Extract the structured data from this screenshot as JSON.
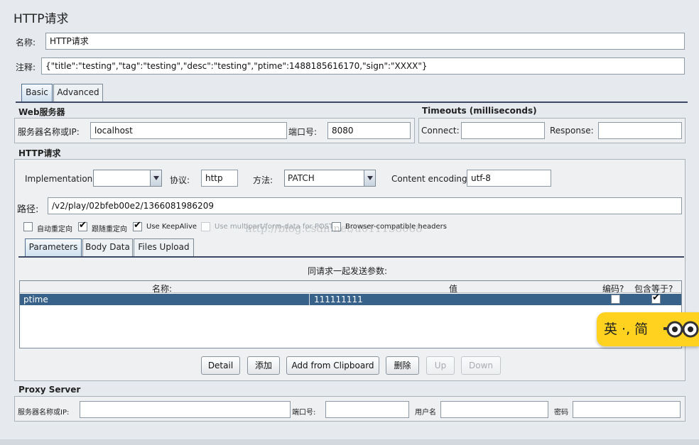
{
  "title": "HTTP请求",
  "name": {
    "label": "名称:",
    "value": "HTTP请求"
  },
  "comment": {
    "label": "注释:",
    "value": "{\"title\":\"testing\",\"tag\":\"testing\",\"desc\":\"testing\",\"ptime\":1488185616170,\"sign\":\"XXXX\"}"
  },
  "main_tabs": [
    "Basic",
    "Advanced"
  ],
  "web_server": {
    "title": "Web服务器",
    "server_label": "服务器名称或IP:",
    "server_value": "localhost",
    "port_label": "端口号:",
    "port_value": "8080"
  },
  "timeouts": {
    "title": "Timeouts (milliseconds)",
    "connect_label": "Connect:",
    "connect_value": "",
    "response_label": "Response:",
    "response_value": ""
  },
  "http_request": {
    "title": "HTTP请求",
    "impl_label": "Implementation:",
    "impl_value": "",
    "protocol_label": "协议:",
    "protocol_value": "http",
    "method_label": "方法:",
    "method_value": "PATCH",
    "encoding_label": "Content encoding:",
    "encoding_value": "utf-8",
    "path_label": "路径:",
    "path_value": "/v2/play/02bfeb00e2/1366081986209"
  },
  "options": [
    {
      "label": "自动重定向",
      "checked": false,
      "enabled": true
    },
    {
      "label": "跟随重定向",
      "checked": true,
      "enabled": true
    },
    {
      "label": "Use KeepAlive",
      "checked": true,
      "enabled": true
    },
    {
      "label": "Use multipart/form-data for POST",
      "checked": false,
      "enabled": false
    },
    {
      "label": "Browser-compatible headers",
      "checked": false,
      "enabled": true
    }
  ],
  "param_tabs": [
    "Parameters",
    "Body Data",
    "Files Upload"
  ],
  "params": {
    "caption": "同请求一起发送参数:",
    "columns": [
      "名称:",
      "值",
      "编码?",
      "包含等于?"
    ],
    "rows": [
      {
        "name": "ptime",
        "value": "111111111",
        "encode": false,
        "include_equals": true
      }
    ]
  },
  "buttons": {
    "detail": "Detail",
    "add": "添加",
    "clipboard": "Add from Clipboard",
    "delete": "删除",
    "up": "Up",
    "down": "Down"
  },
  "proxy": {
    "title": "Proxy Server",
    "server_label": "服务器名称或IP:",
    "port_label": "端口号:",
    "user_label": "用户名",
    "pass_label": "密码"
  },
  "watermark": "http://blog.csdn.net/u011138068",
  "ime_widget": {
    "text": "英 ·, 简"
  }
}
